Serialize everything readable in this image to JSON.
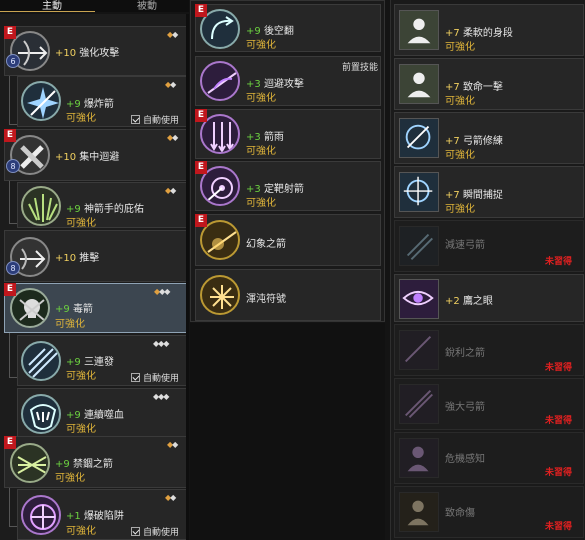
{
  "tabs": {
    "active": "主動",
    "inactive": "被動"
  },
  "prereq_label": "前置技能",
  "auto_use": "自動使用",
  "colors": {
    "upgrade": "#e0b53a",
    "plus": "#f0d060",
    "plus_green": "#6cd040",
    "locked": "#e02020",
    "badge": "#c0171d"
  },
  "col1": [
    {
      "plus": "+10",
      "name": "強化攻擊",
      "sub": "",
      "badge": "E",
      "lvl": "6",
      "diamonds": "◆◆",
      "icon": "bow-arrow-icon"
    },
    {
      "plus": "+9",
      "name": "爆炸箭",
      "sub": "可強化",
      "diamonds": "◆◆",
      "auto": true,
      "icon": "explosion-arrow-icon"
    },
    {
      "plus": "+10",
      "name": "集中迴避",
      "sub": "",
      "badge": "E",
      "lvl": "8",
      "diamonds": "◆◆",
      "icon": "dodge-icon"
    },
    {
      "plus": "+9",
      "name": "神箭手的庇佑",
      "sub": "可強化",
      "diamonds": "◆◆",
      "icon": "blessing-icon"
    },
    {
      "plus": "+10",
      "name": "推擊",
      "sub": "",
      "lvl": "8",
      "diamonds": "",
      "icon": "push-icon"
    },
    {
      "plus": "+9",
      "name": "毒箭",
      "sub": "可強化",
      "badge": "E",
      "diamonds": "◆◆◆",
      "icon": "poison-arrow-icon"
    },
    {
      "plus": "+9",
      "name": "三連發",
      "sub": "可強化",
      "diamonds": "◆◆◆",
      "auto": true,
      "icon": "triple-shot-icon"
    },
    {
      "plus": "+9",
      "name": "連續噬血",
      "sub": "可強化",
      "diamonds": "◆◆◆",
      "icon": "bloodsuck-icon"
    },
    {
      "plus": "+9",
      "name": "禁錮之箭",
      "sub": "可強化",
      "badge": "E",
      "diamonds": "◆◆",
      "icon": "binding-arrow-icon"
    },
    {
      "plus": "+1",
      "name": "爆破陷阱",
      "sub": "可強化",
      "diamonds": "◆◆",
      "auto": true,
      "icon": "trap-icon"
    }
  ],
  "col2": [
    {
      "plus": "+9",
      "name": "後空翻",
      "sub": "可強化",
      "badge": "E",
      "icon": "backflip-icon"
    },
    {
      "plus": "+3",
      "name": "迴避攻擊",
      "sub": "可強化",
      "icon": "evasion-attack-icon"
    },
    {
      "plus": "+3",
      "name": "箭雨",
      "sub": "可強化",
      "badge": "E",
      "icon": "arrow-rain-icon"
    },
    {
      "plus": "+3",
      "name": "定靶射箭",
      "sub": "可強化",
      "badge": "E",
      "icon": "target-shot-icon"
    },
    {
      "plus": "",
      "name": "幻象之箭",
      "sub": "",
      "badge": "E",
      "icon": "illusion-arrow-icon"
    },
    {
      "plus": "",
      "name": "渾沌符號",
      "sub": "",
      "icon": "chaos-symbol-icon"
    }
  ],
  "col3": [
    {
      "plus": "+7",
      "name": "柔軟的身段",
      "sub": "可強化",
      "icon": "body-icon",
      "locked": false
    },
    {
      "plus": "+7",
      "name": "致命一擊",
      "sub": "可強化",
      "icon": "body-icon",
      "locked": false
    },
    {
      "plus": "+7",
      "name": "弓箭修練",
      "sub": "可強化",
      "icon": "bow-training-icon",
      "locked": false
    },
    {
      "plus": "+7",
      "name": "瞬間捕捉",
      "sub": "可強化",
      "icon": "capture-icon",
      "locked": false
    },
    {
      "plus": "",
      "name": "減速弓箭",
      "sub": "未習得",
      "icon": "slow-arrow-icon",
      "locked": true
    },
    {
      "plus": "+2",
      "name": "鷹之眼",
      "sub": "",
      "icon": "hawk-eye-icon",
      "locked": false
    },
    {
      "plus": "",
      "name": "銳利之箭",
      "sub": "未習得",
      "icon": "sharp-arrow-icon",
      "locked": true
    },
    {
      "plus": "",
      "name": "強大弓箭",
      "sub": "未習得",
      "icon": "strong-bow-icon",
      "locked": true
    },
    {
      "plus": "",
      "name": "危機感知",
      "sub": "未習得",
      "icon": "danger-sense-icon",
      "locked": true
    },
    {
      "plus": "",
      "name": "致命傷",
      "sub": "未習得",
      "icon": "fatal-wound-icon",
      "locked": true
    }
  ]
}
